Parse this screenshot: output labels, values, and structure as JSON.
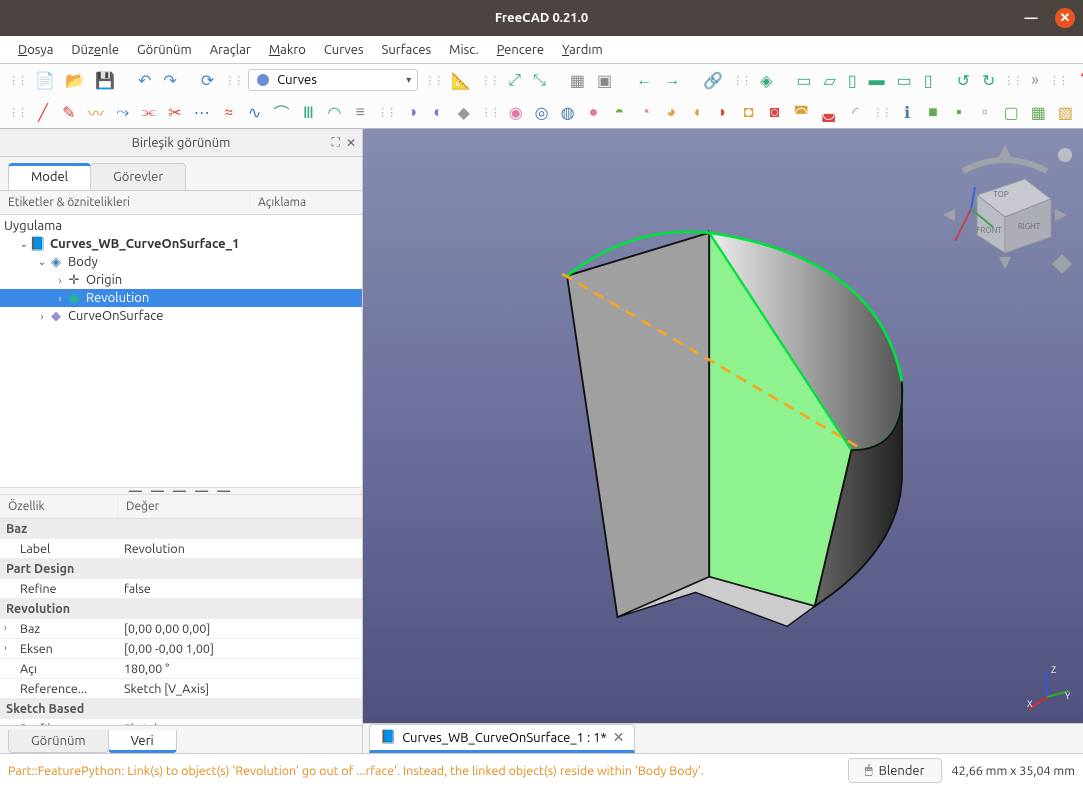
{
  "window": {
    "title": "FreeCAD 0.21.0"
  },
  "menu": {
    "file": "Dosya",
    "edit": "Düzenle",
    "view": "Görünüm",
    "tools": "Araçlar",
    "macro": "Makro",
    "curves": "Curves",
    "surfaces": "Surfaces",
    "misc": "Misc.",
    "windows": "Pencere",
    "help": "Yardım"
  },
  "workbench": {
    "label": "Curves"
  },
  "panel": {
    "title": "Birleşik görünüm"
  },
  "tabs": {
    "model": "Model",
    "tasks": "Görevler"
  },
  "tree_headers": {
    "label": "Etiketler & öznitelikleri",
    "desc": "Açıklama"
  },
  "tree": {
    "app": "Uygulama",
    "doc": "Curves_WB_CurveOnSurface_1",
    "body": "Body",
    "origin": "Origin",
    "revolution": "Revolution",
    "curve": "CurveOnSurface"
  },
  "prop_headers": {
    "key": "Özellik",
    "value": "Değer"
  },
  "props": {
    "baz_group": "Baz",
    "label_k": "Label",
    "label_v": "Revolution",
    "pd_group": "Part Design",
    "refine_k": "Refine",
    "refine_v": "false",
    "rev_group": "Revolution",
    "baz_k": "Baz",
    "baz_v": "[0,00 0,00 0,00]",
    "eksen_k": "Eksen",
    "eksen_v": "[0,00 -0,00 1,00]",
    "aci_k": "Açı",
    "aci_v": "180,00 °",
    "ref_k": "Reference...",
    "ref_v": "Sketch [V_Axis]",
    "sb_group": "Sketch Based",
    "profile_k": "Profile",
    "profile_v": "Sketch"
  },
  "bottom_tabs": {
    "view": "Görünüm",
    "data": "Veri"
  },
  "doc_tab": {
    "label": "Curves_WB_CurveOnSurface_1 : 1*"
  },
  "status": {
    "message": "Part::FeaturePython: Link(s) to object(s) 'Revolution' go out of ...rface'. Instead, the linked object(s) reside within 'Body Body'.",
    "nav": "Blender",
    "dims": "42,66 mm x 35,04 mm"
  },
  "navcube": {
    "top": "TOP",
    "front": "FRONT",
    "right": "RIGHT"
  }
}
